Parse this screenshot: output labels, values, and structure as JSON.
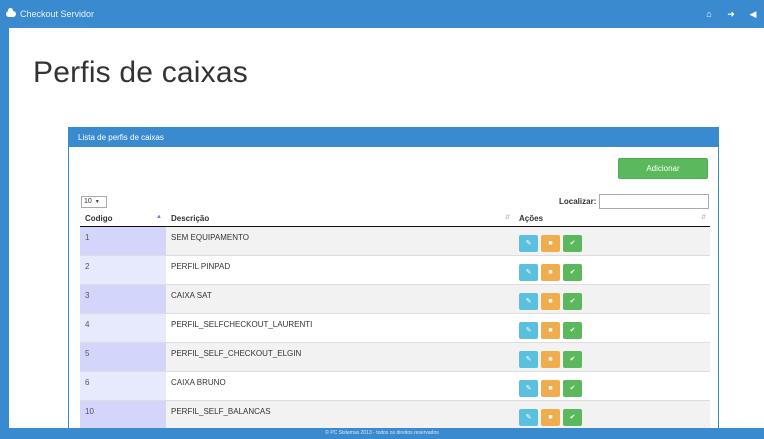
{
  "navbar": {
    "brand": "Checkout Servidor",
    "icons": [
      "home-icon",
      "sign-out-icon",
      "arrow-left-icon"
    ]
  },
  "page": {
    "title": "Perfis de caixas"
  },
  "panel": {
    "heading": "Lista de perfis de caixas",
    "add_button": "Adicionar",
    "page_length": "10",
    "search_label": "Localizar:",
    "search_value": ""
  },
  "table": {
    "headers": [
      "Codigo",
      "Descrição",
      "Ações"
    ],
    "rows": [
      {
        "code": "1",
        "desc": "SEM EQUIPAMENTO"
      },
      {
        "code": "2",
        "desc": "PERFIL PINPAD"
      },
      {
        "code": "3",
        "desc": "CAIXA SAT"
      },
      {
        "code": "4",
        "desc": "PERFIL_SELFCHECKOUT_LAURENTI"
      },
      {
        "code": "5",
        "desc": "PERFIL_SELF_CHECKOUT_ELGIN"
      },
      {
        "code": "6",
        "desc": "CAIXA BRUNO"
      },
      {
        "code": "10",
        "desc": "PERFIL_SELF_BALANCAS"
      }
    ],
    "action_icons": [
      "edit-icon",
      "trash-icon",
      "check-circle-icon"
    ]
  },
  "footer": {
    "text": "© PC Sistemas 2013 - todos os direitos reservados"
  },
  "colors": {
    "primary": "#3a8ad0",
    "success": "#5cb85c",
    "info": "#5bc0de",
    "warning": "#f0ad4e"
  }
}
